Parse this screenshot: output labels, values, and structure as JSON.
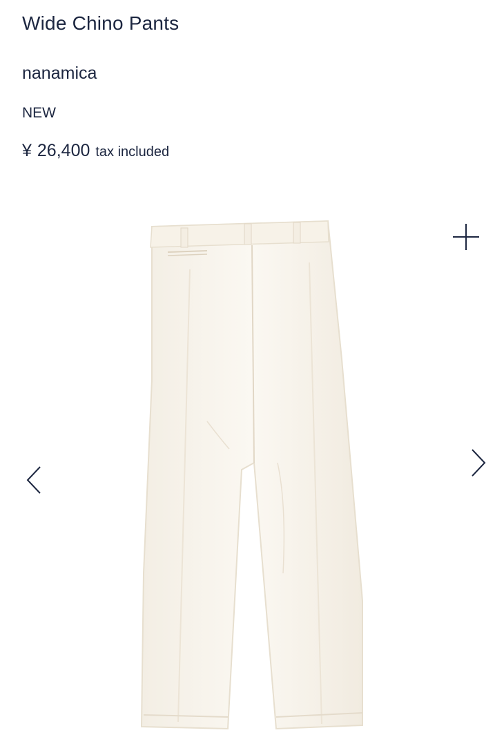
{
  "product": {
    "title": "Wide Chino Pants",
    "brand": "nanamica",
    "condition": "NEW",
    "price_symbol": "¥",
    "price_amount": "26,400",
    "tax_note": "tax included"
  },
  "gallery": {
    "image_subject": "off-white wide chino pants",
    "icons": {
      "zoom": "plus-icon",
      "prev": "chevron-left-icon",
      "next": "chevron-right-icon"
    }
  },
  "colors": {
    "text": "#1c2640",
    "garment": "#f6f1e7",
    "background": "#ffffff"
  }
}
